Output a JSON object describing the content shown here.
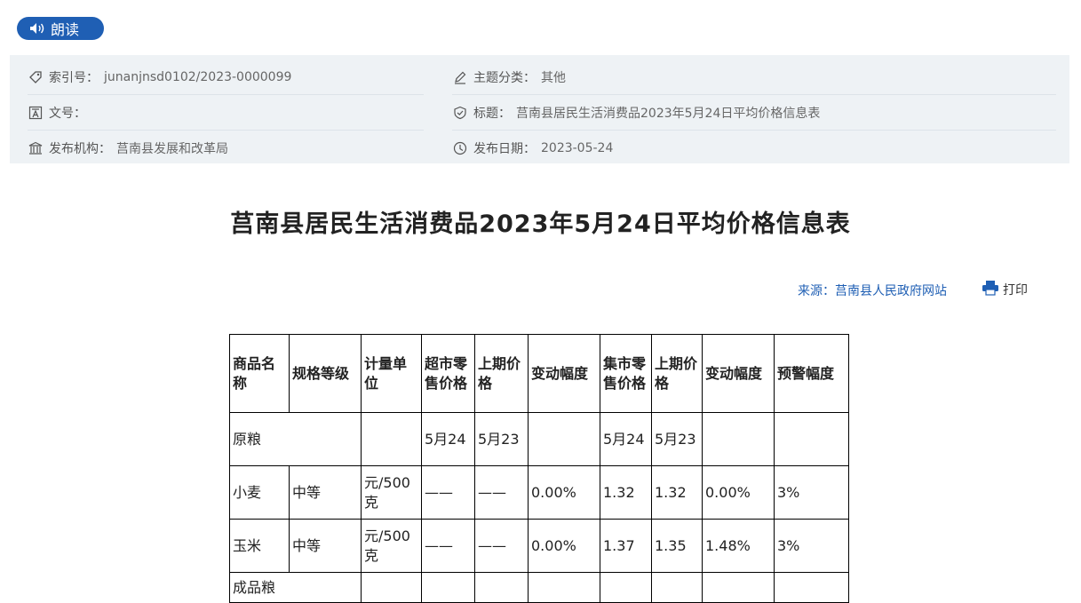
{
  "read_button": {
    "label": "朗读",
    "icon": "speaker-icon"
  },
  "meta": {
    "index_label": "索引号：",
    "index_value": "junanjnsd0102/2023-0000099",
    "doc_no_label": "文号：",
    "doc_no_value": "",
    "org_label": "发布机构：",
    "org_value": "莒南县发展和改革局",
    "topic_label": "主题分类：",
    "topic_value": "其他",
    "title_label": "标题：",
    "title_value": "莒南县居民生活消费品2023年5月24日平均价格信息表",
    "date_label": "发布日期：",
    "date_value": "2023-05-24"
  },
  "document_title": "莒南县居民生活消费品2023年5月24日平均价格信息表",
  "source": {
    "label": "来源：",
    "value": "莒南县人民政府网站"
  },
  "print": {
    "label": "打印",
    "icon": "printer-icon"
  },
  "table": {
    "headers": [
      "商品名称",
      "规格等级",
      "计量单位",
      "超市零售价格",
      "上期价格",
      "变动幅度",
      "集市零售价格",
      "上期价格",
      "变动幅度",
      "预警幅度"
    ],
    "category_1": "原粮",
    "date_row": {
      "sm_cur": "5月24",
      "sm_prev": "5月23",
      "mk_cur": "5月24",
      "mk_prev": "5月23"
    },
    "rows": [
      {
        "name": "小麦",
        "grade": "中等",
        "unit": "元/500克",
        "sm_price": "——",
        "sm_prev": "——",
        "sm_change": "0.00%",
        "mk_price": "1.32",
        "mk_prev": "1.32",
        "mk_change": "0.00%",
        "warn": "3%"
      },
      {
        "name": "玉米",
        "grade": "中等",
        "unit": "元/500克",
        "sm_price": "——",
        "sm_prev": "——",
        "sm_change": "0.00%",
        "mk_price": "1.37",
        "mk_prev": "1.35",
        "mk_change": "1.48%",
        "warn": "3%"
      }
    ],
    "category_2": "成品粮"
  },
  "colors": {
    "accent": "#1f5fb4",
    "panel_bg": "#eef2f5"
  }
}
